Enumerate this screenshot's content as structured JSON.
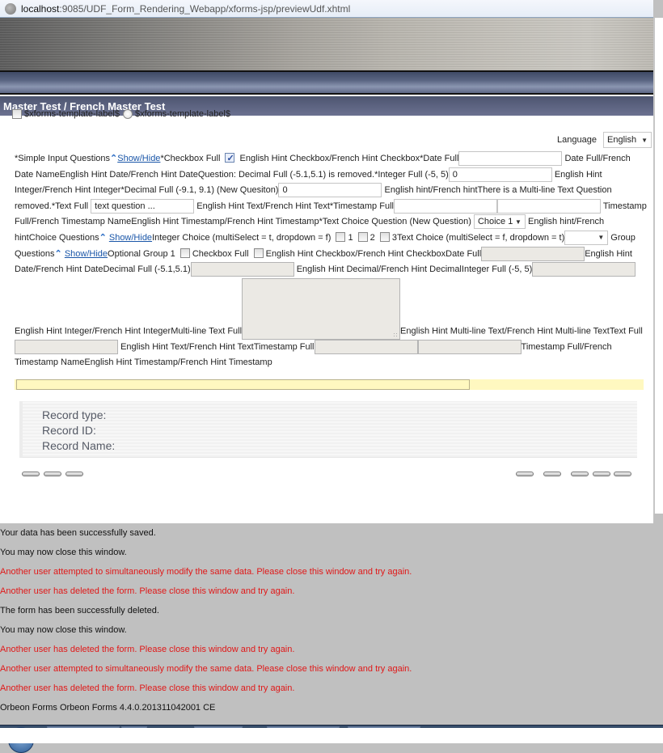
{
  "browser": {
    "url_host": "localhost",
    "url_rest": ":9085/UDF_Form_Rendering_Webapp/xforms-jsp/previewUdf.xhtml"
  },
  "header": {
    "title": "Master Test / French Master Test"
  },
  "template_row": {
    "checkbox_label": "$xforms-template-label$",
    "radio_label": "$xforms-template-label$"
  },
  "language": {
    "label": "Language",
    "selected": "English"
  },
  "form": {
    "simple_section_label": "*Simple Input Questions",
    "show_hide": "Show/Hide",
    "checkbox_full_label": "*Checkbox Full",
    "checkbox_full_checked": true,
    "checkbox_hint": "English Hint Checkbox/French Hint Checkbox",
    "date_full_label": "*Date Full",
    "date_full_value": "",
    "date_hint": "Date Full/French Date NameEnglish Hint Date/French Hint Date",
    "decimal_removed_notice": "Question: Decimal Full (-5.1,5.1) is removed.",
    "integer_full_label": "*Integer Full (-5, 5)",
    "integer_full_value": "0",
    "integer_hint": "English Hint Integer/French Hint Integer",
    "decimal_new_label": "*Decimal Full (-9.1, 9.1) (New Quesiton)",
    "decimal_new_value": "0",
    "decimal_new_hint": "English hint/French hint",
    "multiline_removed_notice": "There is a Multi-line Text Question removed.",
    "text_full_label": "*Text Full",
    "text_full_value": "text question ...",
    "text_hint": "English Hint Text/French Hint Text",
    "timestamp_full_label": "*Timestamp Full",
    "timestamp_date_value": "",
    "timestamp_time_value": "",
    "timestamp_hint": "Timestamp Full/French Timestamp NameEnglish Hint Timestamp/French Hint Timestamp",
    "text_choice_label": "*Text Choice Question (New Question)",
    "text_choice_value": "Choice 1",
    "text_choice_hint": "English hint/French hint",
    "choice_section_label": "Choice Questions",
    "integer_choice_label": "Integer Choice (multiSelect = t, dropdown = f)",
    "integer_choice_options": [
      {
        "label": "1",
        "checked": false
      },
      {
        "label": "2",
        "checked": false
      },
      {
        "label": "3",
        "checked": false
      }
    ],
    "text_choice2_label": "Text Choice (multiSelect = f, dropdown = t)",
    "text_choice2_value": "",
    "group_section_label": "Group Questions",
    "optional_group_label": "Optional Group 1",
    "og_checkbox_full_label": "Checkbox Full",
    "og_checkbox_hint": "English Hint Checkbox/French Hint Checkbox",
    "og_date_label": "Date Full",
    "og_date_hint": "English Hint Date/French Hint Date",
    "og_decimal_label": "Decimal Full (-5.1,5.1)",
    "og_decimal_hint": "English Hint Decimal/French Hint Decimal",
    "og_integer_label": "Integer Full (-5, 5)",
    "og_integer_hint": "English Hint Integer/French Hint Integer",
    "og_multiline_label": "Multi-line Text Full",
    "og_multiline_hint": "English Hint Multi-line Text/French Hint Multi-line Text",
    "og_text_label": "Text Full",
    "og_text_hint": "English Hint Text/French Hint Text",
    "og_timestamp_label": "Timestamp Full",
    "og_timestamp_hint": "Timestamp Full/French Timestamp NameEnglish Hint Timestamp/French Hint Timestamp"
  },
  "record": {
    "type_label": "Record type:",
    "id_label": "Record ID:",
    "name_label": "Record Name:"
  },
  "messages": [
    {
      "text": "Your data has been successfully saved.",
      "type": "info"
    },
    {
      "text": "You may now close this window.",
      "type": "info"
    },
    {
      "text": "Another user attempted to simultaneously modify the same data. Please close this window and try again.",
      "type": "error"
    },
    {
      "text": "Another user has deleted the form. Please close this window and try again.",
      "type": "error"
    },
    {
      "text": "The form has been successfully deleted.",
      "type": "info"
    },
    {
      "text": "You may now close this window.",
      "type": "info"
    },
    {
      "text": "Another user has deleted the form. Please close this window and try again.",
      "type": "error"
    },
    {
      "text": "Another user attempted to simultaneously modify the same data. Please close this window and try again.",
      "type": "error"
    },
    {
      "text": "Another user has deleted the form. Please close this window and try again.",
      "type": "error"
    },
    {
      "text": "Orbeon Forms Orbeon Forms 4.4.0.201311042001 CE",
      "type": "info"
    }
  ],
  "colors": {
    "error_text": "#e01818",
    "link": "#1a56a8",
    "title_bar": "#5a6080",
    "message_bg": "#c0c0c0",
    "error_bar": "#fff8c0"
  }
}
